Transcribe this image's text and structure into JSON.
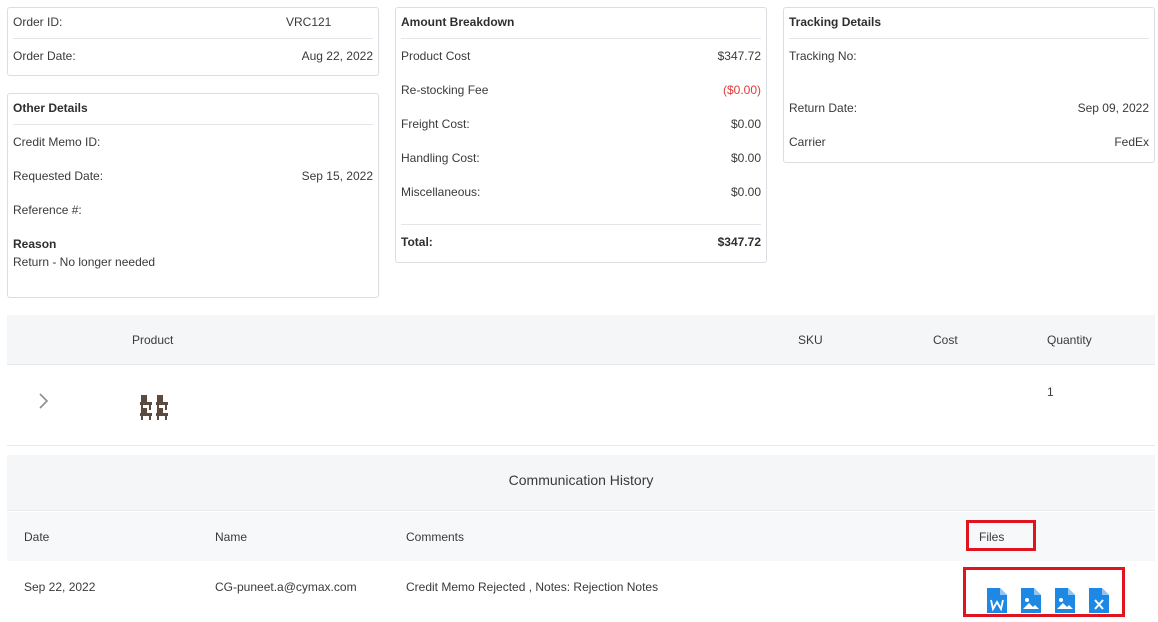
{
  "order": {
    "order_id_label": "Order ID:",
    "order_id": "VRC121",
    "order_date_label": "Order Date:",
    "order_date": "Aug 22, 2022"
  },
  "other_details": {
    "title": "Other Details",
    "credit_memo_label": "Credit Memo ID:",
    "credit_memo": "",
    "requested_date_label": "Requested Date:",
    "requested_date": "Sep 15, 2022",
    "reference_label": "Reference #:",
    "reference": "",
    "reason_label": "Reason",
    "reason": "Return - No longer needed"
  },
  "amount": {
    "title": "Amount Breakdown",
    "rows": [
      {
        "label": "Product Cost",
        "value": "$347.72"
      },
      {
        "label": "Re-stocking Fee",
        "value": "($0.00)"
      },
      {
        "label": "Freight Cost:",
        "value": "$0.00"
      },
      {
        "label": "Handling Cost:",
        "value": "$0.00"
      },
      {
        "label": "Miscellaneous:",
        "value": "$0.00"
      }
    ],
    "total_label": "Total:",
    "total": "$347.72"
  },
  "tracking": {
    "title": "Tracking Details",
    "tracking_no_label": "Tracking No:",
    "tracking_no": "",
    "return_date_label": "Return Date:",
    "return_date": "Sep 09, 2022",
    "carrier_label": "Carrier",
    "carrier": "FedEx"
  },
  "products": {
    "headers": {
      "product": "Product",
      "sku": "SKU",
      "cost": "Cost",
      "quantity": "Quantity"
    },
    "rows": [
      {
        "sku": "",
        "cost": "",
        "quantity": "1"
      }
    ]
  },
  "communication": {
    "title": "Communication History",
    "headers": {
      "date": "Date",
      "name": "Name",
      "comments": "Comments",
      "files": "Files"
    },
    "rows": [
      {
        "date": "Sep 22, 2022",
        "name": "CG-puneet.a@cymax.com",
        "comments": "Credit Memo Rejected , Notes: Rejection Notes"
      }
    ],
    "file_icons": [
      "word-file-icon",
      "image-file-icon",
      "image-file-icon",
      "excel-file-icon"
    ]
  },
  "colors": {
    "accent_blue": "#1e88e5",
    "negative_red": "#e03b3b",
    "highlight_red": "#e0141e"
  }
}
